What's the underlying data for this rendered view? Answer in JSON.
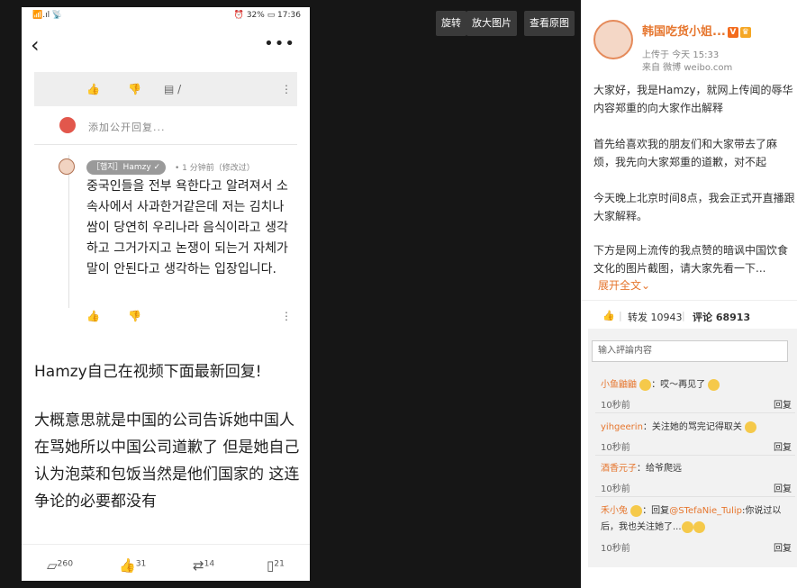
{
  "phone": {
    "status_left": "📶.ıl 📡",
    "status_right": "⏰ 32% ▭ 17:36",
    "actions_top": {
      "like": "👍",
      "dislike": "👎",
      "comment": "▤ /",
      "more": "⋮"
    },
    "add_reply_placeholder": "添加公开回复...",
    "reply": {
      "name": "［햄지］Hamzy ✓",
      "time": "• 1 分钟前（修改过）",
      "text": "중국인들을 전부 욕한다고 알려져서 소속사에서 사과한거같은데 저는 김치나 쌈이 당연히 우리나라 음식이라고 생각하고 그거가지고 논쟁이 되는거 자체가 말이 안된다고 생각하는 입장입니다."
    },
    "caption1": "Hamzy自己在视频下面最新回复!",
    "caption2": "大概意思就是中国的公司告诉她中国人在骂她所以中国公司道歉了 但是她自己认为泡菜和包饭当然是他们国家的 这连争论的必要都没有",
    "bottom": {
      "comments": "260",
      "likes": "31",
      "reposts": "14",
      "saves": "21"
    }
  },
  "viewer": {
    "rotate_label": "旋转",
    "zoom_label": "放大图片",
    "original_label": "查看原图"
  },
  "panel": {
    "author": "韩国吃货小姐...",
    "upload_time": "上传于 今天 15:33",
    "source": "来自 微博 weibo.com",
    "para1": "大家好，我是Hamzy，就网上传闻的辱华内容郑重的向大家作出解释",
    "para2": "首先给喜欢我的朋友们和大家带去了麻烦，我先向大家郑重的道歉，对不起",
    "para3": "今天晚上北京时间8点，我会正式开直播跟大家解释。",
    "para4": "下方是网上流传的我点赞的暗讽中国饮食文化的图片截图，请大家先看一下...",
    "expand": "展开全文",
    "repost_label": "转发 10943",
    "comment_label": "评论 68913",
    "comment_placeholder": "输入評論内容",
    "comments": [
      {
        "user": "小鱼鼬鼬",
        "text": "：哎～再见了",
        "time": "10秒前",
        "reply": "回复"
      },
      {
        "user": "yihgeerin",
        "text": "：关注她的骂完记得取关",
        "time": "10秒前",
        "reply": "回复"
      },
      {
        "user": "酒香元子",
        "text": "：给爷爬远",
        "time": "10秒前",
        "reply": "回复"
      },
      {
        "user": "禾小兔",
        "text": "：回复",
        "mention": "@STefaNie_Tulip",
        "text2": ":你说过以后，我也关注她了...",
        "time": "10秒前",
        "reply": "回复"
      }
    ]
  }
}
